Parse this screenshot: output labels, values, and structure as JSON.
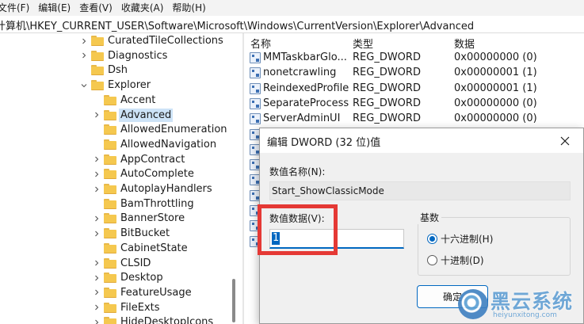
{
  "menubar": {
    "items": [
      "文件(F)",
      "编辑(E)",
      "查看(V)",
      "收藏夹(A)",
      "帮助(H)"
    ]
  },
  "address": {
    "path": "计算机\\HKEY_CURRENT_USER\\Software\\Microsoft\\Windows\\CurrentVersion\\Explorer\\Advanced"
  },
  "tree": {
    "items": [
      {
        "label": "CuratedTileCollections",
        "expander": "collapsed"
      },
      {
        "label": "Diagnostics",
        "expander": "collapsed"
      },
      {
        "label": "Dsh",
        "expander": "none"
      },
      {
        "label": "Explorer",
        "expander": "expanded"
      },
      {
        "label": "Accent",
        "expander": "none"
      },
      {
        "label": "Advanced",
        "expander": "collapsed",
        "selected": true
      },
      {
        "label": "AllowedEnumeration",
        "expander": "none"
      },
      {
        "label": "AllowedNavigation",
        "expander": "none"
      },
      {
        "label": "AppContract",
        "expander": "collapsed"
      },
      {
        "label": "AutoComplete",
        "expander": "collapsed"
      },
      {
        "label": "AutoplayHandlers",
        "expander": "collapsed"
      },
      {
        "label": "BamThrottling",
        "expander": "none"
      },
      {
        "label": "BannerStore",
        "expander": "collapsed"
      },
      {
        "label": "BitBucket",
        "expander": "collapsed"
      },
      {
        "label": "CabinetState",
        "expander": "none"
      },
      {
        "label": "CLSID",
        "expander": "collapsed"
      },
      {
        "label": "Desktop",
        "expander": "collapsed"
      },
      {
        "label": "FeatureUsage",
        "expander": "collapsed"
      },
      {
        "label": "FileExts",
        "expander": "collapsed"
      },
      {
        "label": "HideDesktopIcons",
        "expander": "collapsed"
      }
    ]
  },
  "values": {
    "headers": {
      "name": "名称",
      "type": "类型",
      "data": "数据"
    },
    "rows": [
      {
        "name": "MMTaskbarGlo...",
        "type": "REG_DWORD",
        "data": "0x00000000 (0)"
      },
      {
        "name": "nonetcrawling",
        "type": "REG_DWORD",
        "data": "0x00000001 (1)"
      },
      {
        "name": "ReindexedProfile",
        "type": "REG_DWORD",
        "data": "0x00000001 (1)"
      },
      {
        "name": "SeparateProcess",
        "type": "REG_DWORD",
        "data": "0x00000000 (0)"
      },
      {
        "name": "ServerAdminUI",
        "type": "REG_DWORD",
        "data": "0x00000000 (0)"
      },
      {
        "name": "",
        "type": "",
        "data": ""
      },
      {
        "name": "",
        "type": "",
        "data": ""
      },
      {
        "name": "",
        "type": "",
        "data": ""
      },
      {
        "name": "",
        "type": "",
        "data": ""
      },
      {
        "name": "",
        "type": "",
        "data": ""
      },
      {
        "name": "",
        "type": "",
        "data": ""
      },
      {
        "name": "",
        "type": "",
        "data": ""
      },
      {
        "name": "",
        "type": "",
        "data": ""
      }
    ]
  },
  "dialog": {
    "title": "编辑 DWORD (32 位)值",
    "name_label": "数值名称(N):",
    "name_value": "Start_ShowClassicMode",
    "data_label": "数值数据(V):",
    "data_value": "1",
    "base_label": "基数",
    "radio_hex": "十六进制(H)",
    "radio_dec": "十进制(D)",
    "selected_base": "hex",
    "ok_label": "确定"
  },
  "watermark": {
    "text": "黑云系统",
    "url": "heiyunxitong.com"
  },
  "colors": {
    "accent": "#0067c0",
    "highlight": "#e53935",
    "selection": "#cde3f7",
    "folder": "#f5c84f"
  }
}
